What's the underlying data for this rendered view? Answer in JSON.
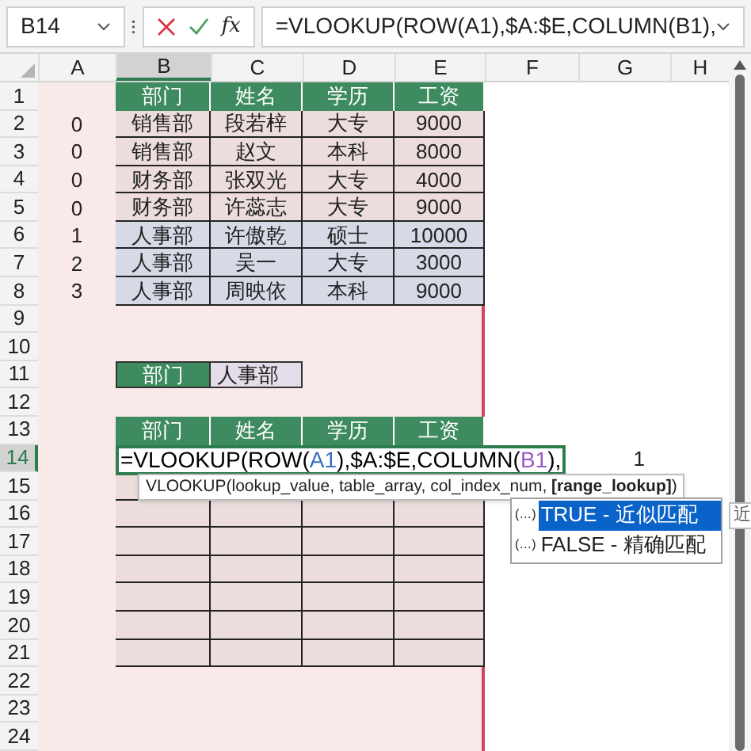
{
  "name_box": {
    "value": "B14"
  },
  "formula_bar": {
    "function_label": "fx",
    "formula": "=VLOOKUP(ROW(A1),$A:$E,COLUMN(B1),"
  },
  "column_headers": [
    {
      "label": "A",
      "selected": false
    },
    {
      "label": "B",
      "selected": true
    },
    {
      "label": "C",
      "selected": false
    },
    {
      "label": "D",
      "selected": false
    },
    {
      "label": "E",
      "selected": false
    },
    {
      "label": "F",
      "selected": false
    },
    {
      "label": "G",
      "selected": false
    },
    {
      "label": "H",
      "selected": false
    }
  ],
  "row_headers": [
    {
      "label": "1",
      "selected": false
    },
    {
      "label": "2",
      "selected": false
    },
    {
      "label": "3",
      "selected": false
    },
    {
      "label": "4",
      "selected": false
    },
    {
      "label": "5",
      "selected": false
    },
    {
      "label": "6",
      "selected": false
    },
    {
      "label": "7",
      "selected": false
    },
    {
      "label": "8",
      "selected": false
    },
    {
      "label": "9",
      "selected": false
    },
    {
      "label": "10",
      "selected": false
    },
    {
      "label": "11",
      "selected": false
    },
    {
      "label": "12",
      "selected": false
    },
    {
      "label": "13",
      "selected": false
    },
    {
      "label": "14",
      "selected": true
    },
    {
      "label": "15",
      "selected": false
    },
    {
      "label": "16",
      "selected": false
    },
    {
      "label": "17",
      "selected": false
    },
    {
      "label": "18",
      "selected": false
    },
    {
      "label": "19",
      "selected": false
    },
    {
      "label": "20",
      "selected": false
    },
    {
      "label": "21",
      "selected": false
    },
    {
      "label": "22",
      "selected": false
    },
    {
      "label": "23",
      "selected": false
    },
    {
      "label": "24",
      "selected": false
    }
  ],
  "source_table": {
    "headers": [
      "部门",
      "姓名",
      "学历",
      "工资"
    ],
    "rows": [
      {
        "helper": "0",
        "cells": [
          "销售部",
          "段若梓",
          "大专",
          "9000"
        ],
        "color": "#ecdcdc"
      },
      {
        "helper": "0",
        "cells": [
          "销售部",
          "赵文",
          "本科",
          "8000"
        ],
        "color": "#ecdcdc"
      },
      {
        "helper": "0",
        "cells": [
          "财务部",
          "张双光",
          "大专",
          "4000"
        ],
        "color": "#ecdcdc"
      },
      {
        "helper": "0",
        "cells": [
          "财务部",
          "许蕊志",
          "大专",
          "9000"
        ],
        "color": "#ecdcdc"
      },
      {
        "helper": "1",
        "cells": [
          "人事部",
          "许傲乾",
          "硕士",
          "10000"
        ],
        "color": "#d6d9e6"
      },
      {
        "helper": "2",
        "cells": [
          "人事部",
          "吴一",
          "大专",
          "3000"
        ],
        "color": "#d6d9e6"
      },
      {
        "helper": "3",
        "cells": [
          "人事部",
          "周映依",
          "本科",
          "9000"
        ],
        "color": "#d6d9e6"
      }
    ]
  },
  "criteria": {
    "label": "部门",
    "value": "人事部"
  },
  "result_table": {
    "headers": [
      "部门",
      "姓名",
      "学历",
      "工资"
    ]
  },
  "cell_editor": {
    "parts": [
      {
        "text": "=VLOOKUP(ROW(",
        "color": "#000000"
      },
      {
        "text": "A1",
        "color": "#3b6fc4"
      },
      {
        "text": "),$A:$E,COLUMN(",
        "color": "#000000"
      },
      {
        "text": "B1",
        "color": "#9a5bc4"
      },
      {
        "text": "),",
        "color": "#000000"
      }
    ]
  },
  "result_value": "1",
  "tooltip": {
    "text": "VLOOKUP(lookup_value, table_array, col_index_num, **[range_lookup]**)"
  },
  "autocomplete": {
    "items": [
      {
        "icon": "(…)",
        "label": "TRUE - 近似匹配",
        "selected": true
      },
      {
        "icon": "(…)",
        "label": "FALSE - 精确匹配",
        "selected": false
      }
    ],
    "side_tip": "近"
  }
}
